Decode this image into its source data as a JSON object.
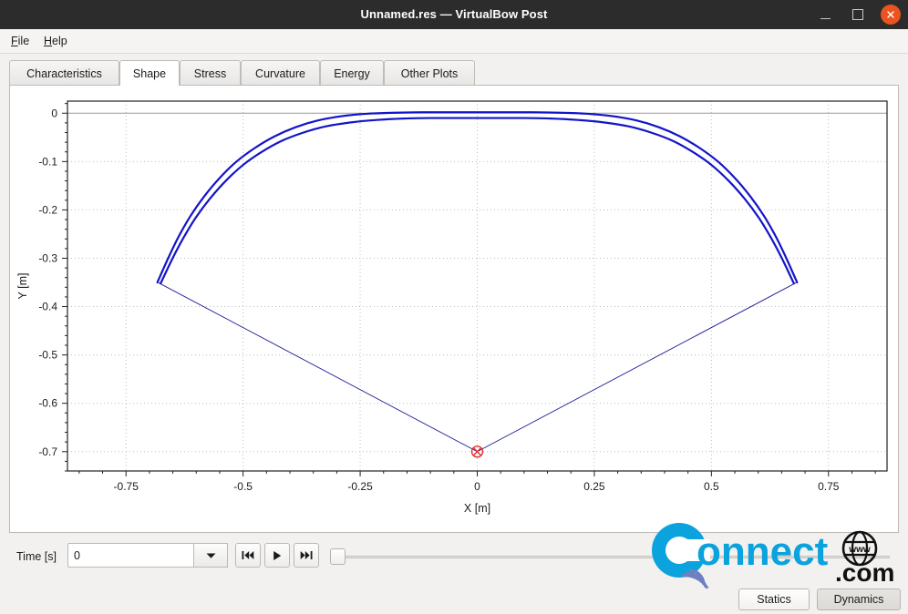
{
  "window": {
    "title": "Unnamed.res — VirtualBow Post",
    "controls": {
      "minimize": "minimize-icon",
      "maximize": "maximize-icon",
      "close": "close-icon"
    }
  },
  "menubar": {
    "items": [
      {
        "label": "File",
        "mnemonic": "F",
        "rest": "ile"
      },
      {
        "label": "Help",
        "mnemonic": "H",
        "rest": "elp"
      }
    ]
  },
  "tabs": [
    {
      "label": "Characteristics",
      "active": false
    },
    {
      "label": "Shape",
      "active": true
    },
    {
      "label": "Stress",
      "active": false
    },
    {
      "label": "Curvature",
      "active": false
    },
    {
      "label": "Energy",
      "active": false
    },
    {
      "label": "Other Plots",
      "active": false
    }
  ],
  "toolbar": {
    "time_label": "Time [s]",
    "time_value": "0",
    "dropdown_icon": "chevron-down-icon",
    "skip_start_icon": "skip-to-start-icon",
    "play_icon": "play-icon",
    "skip_end_icon": "skip-to-end-icon",
    "slider_value": 0
  },
  "mode_buttons": {
    "statics": "Statics",
    "dynamics": "Dynamics",
    "selected": "Dynamics"
  },
  "watermark": {
    "text_main": "onnect",
    "text_c": "C",
    "text_com": ".com",
    "text_www": "www",
    "color_blue": "#0aa3dd",
    "color_black": "#111111"
  },
  "chart_data": {
    "type": "line",
    "title": "",
    "xlabel": "X [m]",
    "ylabel": "Y [m]",
    "xlim": [
      -0.875,
      0.875
    ],
    "ylim": [
      -0.74,
      0.025
    ],
    "xticks": [
      -0.75,
      -0.5,
      -0.25,
      0,
      0.25,
      0.5,
      0.75
    ],
    "xticklabels": [
      "-0.75",
      "-0.5",
      "-0.25",
      "0",
      "0.25",
      "0.5",
      "0.75"
    ],
    "yticks": [
      0,
      -0.1,
      -0.2,
      -0.3,
      -0.4,
      -0.5,
      -0.6,
      -0.7
    ],
    "yticklabels": [
      "0",
      "-0.1",
      "-0.2",
      "-0.3",
      "-0.4",
      "-0.5",
      "-0.6",
      "-0.7"
    ],
    "grid": true,
    "grid_style": "dotted",
    "zero_line_y": 0,
    "legend": null,
    "series": [
      {
        "name": "limb-outer-back",
        "color": "#1414c8",
        "width": 2.2,
        "points": [
          [
            -0.683,
            -0.35
          ],
          [
            -0.66,
            -0.3
          ],
          [
            -0.638,
            -0.256
          ],
          [
            -0.612,
            -0.212
          ],
          [
            -0.583,
            -0.172
          ],
          [
            -0.55,
            -0.134
          ],
          [
            -0.514,
            -0.1
          ],
          [
            -0.475,
            -0.072
          ],
          [
            -0.433,
            -0.048
          ],
          [
            -0.388,
            -0.029
          ],
          [
            -0.34,
            -0.015
          ],
          [
            -0.288,
            -0.006
          ],
          [
            -0.233,
            -0.001
          ],
          [
            -0.175,
            0.001
          ],
          [
            -0.115,
            0.002
          ],
          [
            -0.055,
            0.002
          ],
          [
            0.0,
            0.002
          ],
          [
            0.055,
            0.002
          ],
          [
            0.115,
            0.002
          ],
          [
            0.175,
            0.001
          ],
          [
            0.233,
            -0.001
          ],
          [
            0.288,
            -0.006
          ],
          [
            0.34,
            -0.015
          ],
          [
            0.388,
            -0.029
          ],
          [
            0.433,
            -0.048
          ],
          [
            0.475,
            -0.072
          ],
          [
            0.514,
            -0.1
          ],
          [
            0.55,
            -0.134
          ],
          [
            0.583,
            -0.172
          ],
          [
            0.612,
            -0.212
          ],
          [
            0.638,
            -0.256
          ],
          [
            0.66,
            -0.3
          ],
          [
            0.683,
            -0.35
          ]
        ]
      },
      {
        "name": "limb-inner-belly",
        "color": "#1414c8",
        "width": 2.2,
        "points": [
          [
            -0.676,
            -0.352
          ],
          [
            -0.652,
            -0.303
          ],
          [
            -0.628,
            -0.259
          ],
          [
            -0.601,
            -0.216
          ],
          [
            -0.571,
            -0.177
          ],
          [
            -0.537,
            -0.14
          ],
          [
            -0.5,
            -0.107
          ],
          [
            -0.46,
            -0.08
          ],
          [
            -0.417,
            -0.057
          ],
          [
            -0.371,
            -0.04
          ],
          [
            -0.322,
            -0.027
          ],
          [
            -0.27,
            -0.019
          ],
          [
            -0.215,
            -0.014
          ],
          [
            -0.157,
            -0.011
          ],
          [
            -0.1,
            -0.01
          ],
          [
            -0.05,
            -0.01
          ],
          [
            0.0,
            -0.01
          ],
          [
            0.05,
            -0.01
          ],
          [
            0.1,
            -0.01
          ],
          [
            0.157,
            -0.011
          ],
          [
            0.215,
            -0.014
          ],
          [
            0.27,
            -0.019
          ],
          [
            0.322,
            -0.027
          ],
          [
            0.371,
            -0.04
          ],
          [
            0.417,
            -0.057
          ],
          [
            0.46,
            -0.08
          ],
          [
            0.5,
            -0.107
          ],
          [
            0.537,
            -0.14
          ],
          [
            0.571,
            -0.177
          ],
          [
            0.601,
            -0.216
          ],
          [
            0.628,
            -0.259
          ],
          [
            0.652,
            -0.303
          ],
          [
            0.676,
            -0.352
          ]
        ]
      },
      {
        "name": "bow-string",
        "color": "#1a1a96",
        "width": 0.9,
        "points": [
          [
            -0.68,
            -0.351
          ],
          [
            0.0,
            -0.7
          ],
          [
            0.68,
            -0.351
          ]
        ]
      }
    ],
    "markers": [
      {
        "name": "arrow-nock",
        "x": 0.0,
        "y": -0.7,
        "shape": "circle-x",
        "color": "#e03030",
        "radius": 6
      }
    ]
  }
}
